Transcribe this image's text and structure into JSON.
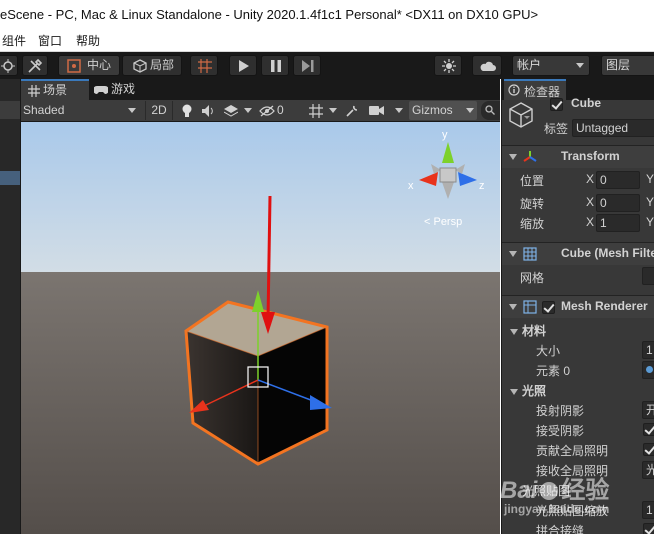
{
  "window": {
    "title": "eScene - PC, Mac & Linux Standalone - Unity 2020.1.4f1c1 Personal* <DX11 on DX10 GPU>"
  },
  "menu": {
    "items": [
      "组件",
      "窗口",
      "帮助"
    ]
  },
  "toolbar": {
    "pivot_label": "中心",
    "space_label": "局部",
    "account_label": "帐户",
    "layers_label": "图层"
  },
  "scene": {
    "tabs": [
      {
        "label": "场景"
      },
      {
        "label": "游戏"
      }
    ],
    "shading_mode": "Shaded",
    "mode_2d": "2D",
    "hidden_count": "0",
    "gizmos_label": "Gizmos",
    "projection_label": "< Persp",
    "axes": {
      "x": "x",
      "y": "y",
      "z": "z"
    }
  },
  "inspector": {
    "tab_label": "检查器",
    "object_name": "Cube",
    "tag_label": "标签",
    "tag_value": "Untagged",
    "transform": {
      "title": "Transform",
      "rows": [
        {
          "label": "位置",
          "axis": "X",
          "value": "0",
          "axis2": "Y"
        },
        {
          "label": "旋转",
          "axis": "X",
          "value": "0",
          "axis2": "Y"
        },
        {
          "label": "缩放",
          "axis": "X",
          "value": "1",
          "axis2": "Y"
        }
      ]
    },
    "mesh_filter": {
      "title": "Cube (Mesh Filter)",
      "mesh_label": "网格"
    },
    "mesh_renderer": {
      "title": "Mesh Renderer",
      "materials_label": "材料",
      "size_label": "大小",
      "size_value": "1",
      "element_label": "元素 0",
      "lighting_label": "光照",
      "cast_shadows_label": "投射阴影",
      "cast_shadows_value": "开",
      "receive_shadows_label": "接受阴影",
      "contribute_gi_label": "贡献全局照明",
      "receive_gi_label": "接收全局照明",
      "receive_gi_value": "光",
      "lightmap_label": "光照贴图",
      "lightmap_scale_label": "光照贴图缩放",
      "lightmap_scale_value": "1",
      "stitch_seams_label": "拼合接缝"
    }
  },
  "watermark": {
    "line1": "Bai",
    "line2": "经验",
    "url": "jingyan.baidu.com"
  },
  "colors": {
    "x_axis": "#e8331c",
    "y_axis": "#7dd12b",
    "z_axis": "#2e6fe8",
    "selection": "#f37421",
    "sky": "#bcd5ee"
  }
}
